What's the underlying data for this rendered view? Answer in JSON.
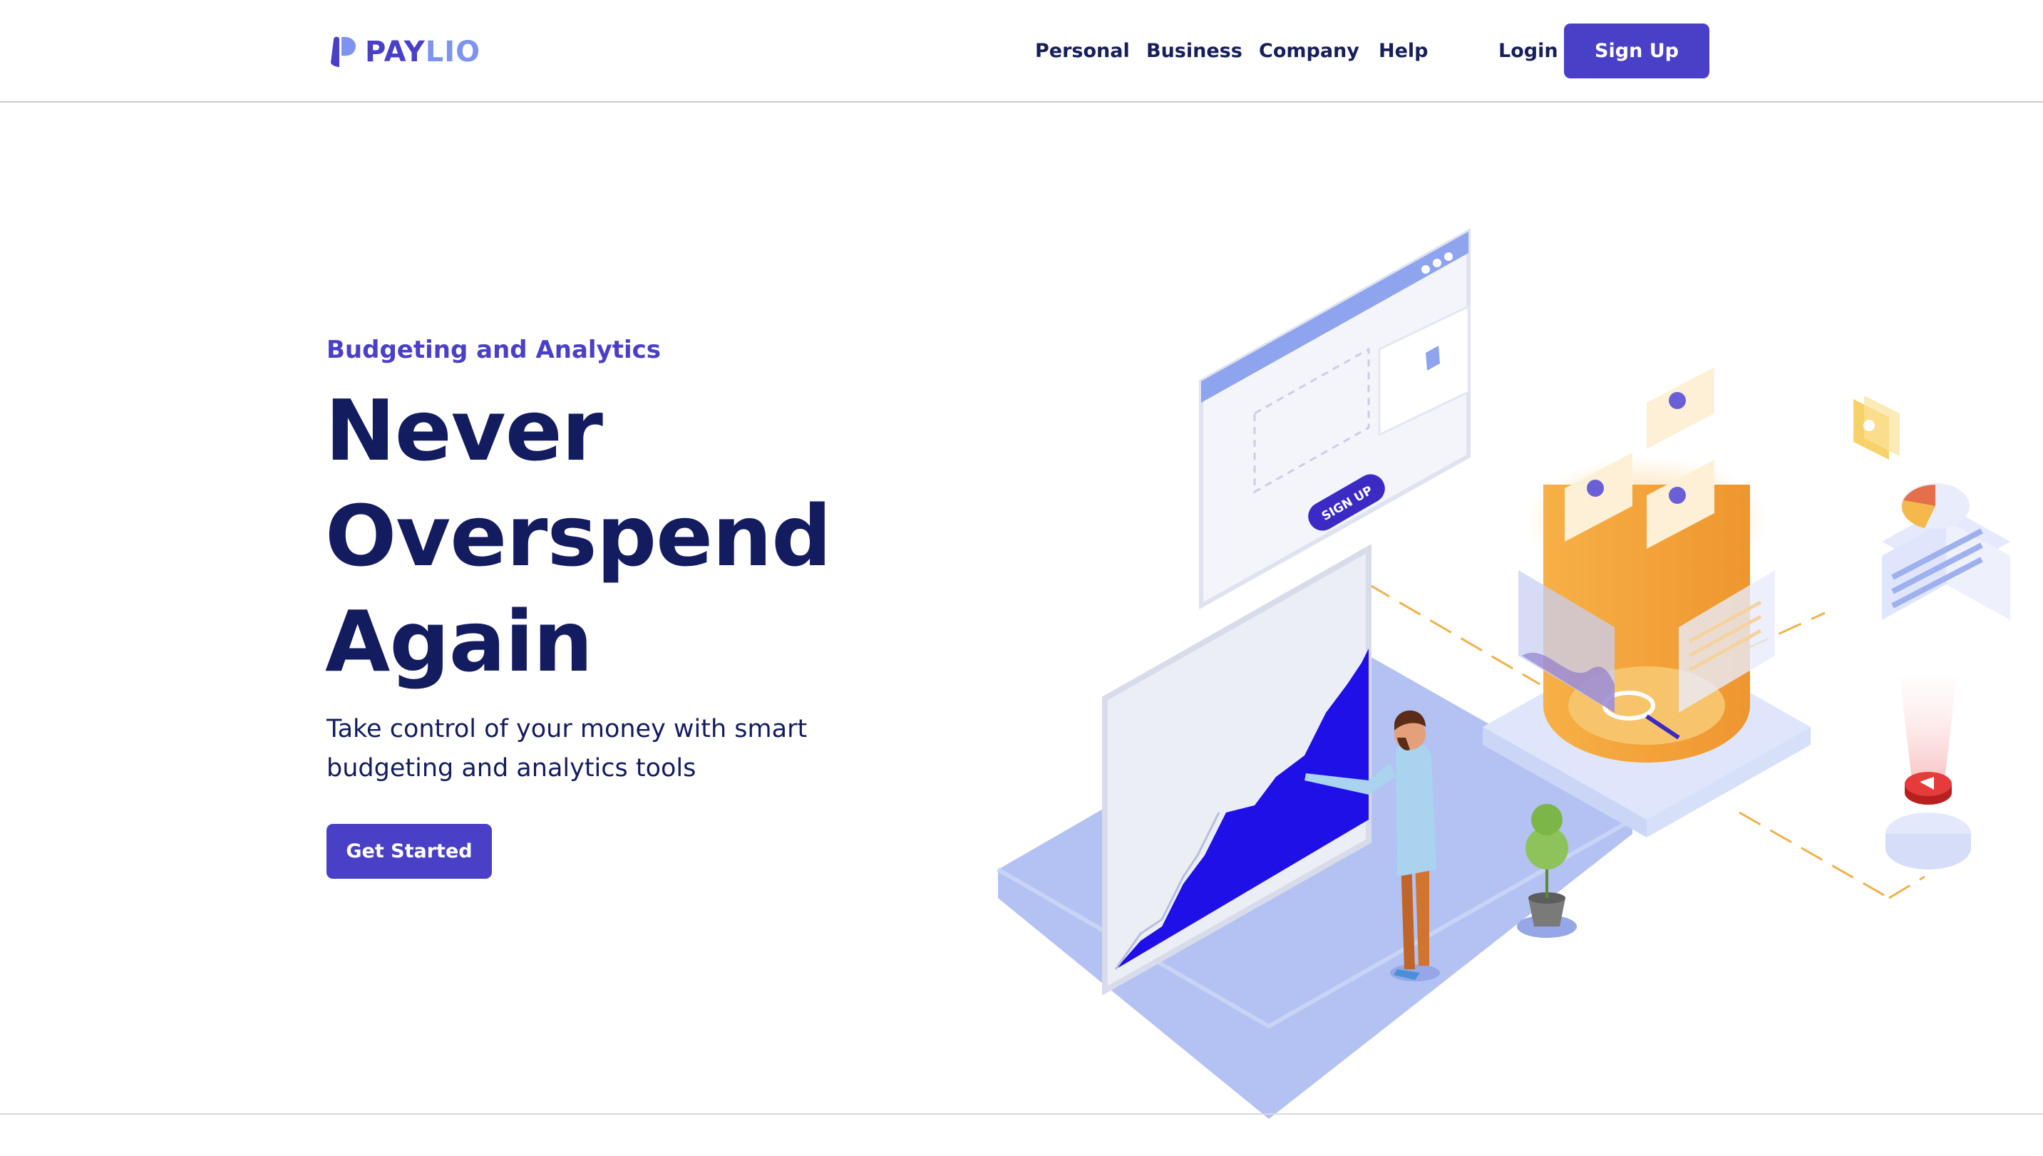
{
  "brand": {
    "name_part1": "PAY",
    "name_part2": "LIO",
    "colors": {
      "primary": "#4a40c7",
      "secondary": "#7d93ef",
      "heading": "#141c60"
    }
  },
  "nav": {
    "items": [
      {
        "label": "Personal"
      },
      {
        "label": "Business"
      },
      {
        "label": "Company"
      },
      {
        "label": "Help"
      }
    ],
    "login_label": "Login",
    "signup_label": "Sign Up"
  },
  "hero": {
    "eyebrow": "Budgeting and Analytics",
    "headline_lines": [
      "Never",
      "Overspend",
      "Again"
    ],
    "subtitle": "Take control of your money with smart budgeting and analytics tools",
    "cta_label": "Get Started"
  },
  "illustration": {
    "signup_badge": "SIGN UP"
  }
}
